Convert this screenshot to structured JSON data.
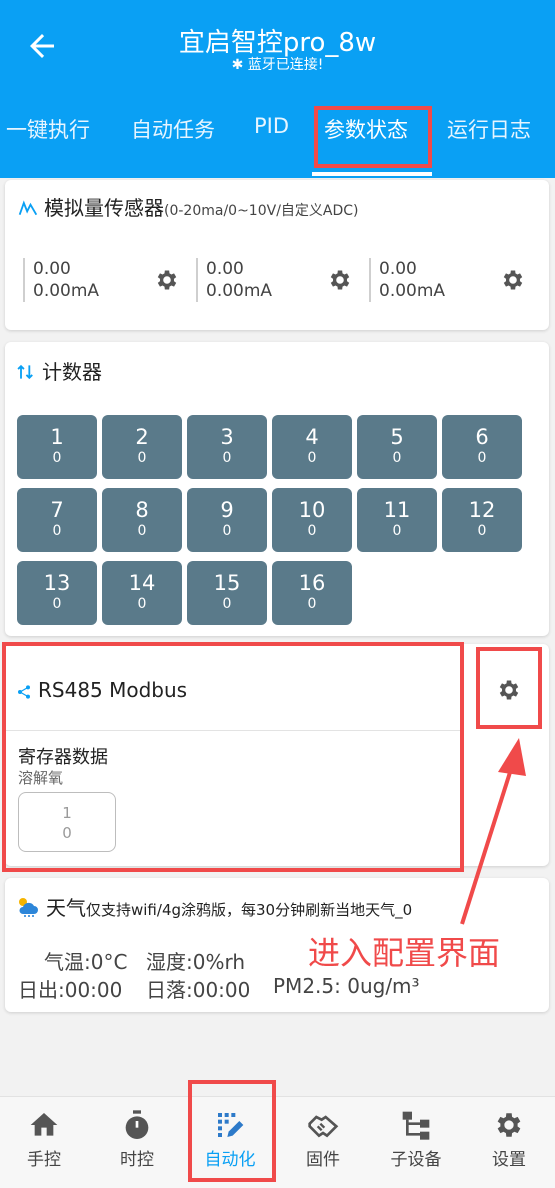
{
  "header": {
    "title": "宜启智控pro_8w",
    "subtitle": "✱ 蓝牙已连接!",
    "back_icon": "arrow-left-icon",
    "bg_color": "#0aa0f4"
  },
  "tabs": [
    {
      "label": "一键执行"
    },
    {
      "label": "自动任务"
    },
    {
      "label": "PID"
    },
    {
      "label": "参数状态",
      "active": true
    },
    {
      "label": "运行日志"
    }
  ],
  "analog": {
    "title": "模拟量传感器",
    "subtitle": "(0-20ma/0~10V/自定义ADC)",
    "channels": [
      {
        "value": "0.00",
        "current": "0.00mA"
      },
      {
        "value": "0.00",
        "current": "0.00mA"
      },
      {
        "value": "0.00",
        "current": "0.00mA"
      }
    ]
  },
  "counter": {
    "title": "计数器",
    "items": [
      {
        "n": "1",
        "v": "0"
      },
      {
        "n": "2",
        "v": "0"
      },
      {
        "n": "3",
        "v": "0"
      },
      {
        "n": "4",
        "v": "0"
      },
      {
        "n": "5",
        "v": "0"
      },
      {
        "n": "6",
        "v": "0"
      },
      {
        "n": "7",
        "v": "0"
      },
      {
        "n": "8",
        "v": "0"
      },
      {
        "n": "9",
        "v": "0"
      },
      {
        "n": "10",
        "v": "0"
      },
      {
        "n": "11",
        "v": "0"
      },
      {
        "n": "12",
        "v": "0"
      },
      {
        "n": "13",
        "v": "0"
      },
      {
        "n": "14",
        "v": "0"
      },
      {
        "n": "15",
        "v": "0"
      },
      {
        "n": "16",
        "v": "0"
      }
    ]
  },
  "modbus": {
    "title": "RS485 Modbus",
    "section": "寄存器数据",
    "register_name": "溶解氧",
    "register_index": "1",
    "register_value": "0"
  },
  "weather": {
    "title": "天气",
    "note": "仅支持wifi/4g涂鸦版，每30分钟刷新当地天气_0",
    "temp": "气温:0°C",
    "humidity": "湿度:0%rh",
    "sunrise": "日出:00:00",
    "sunset": "日落:00:00",
    "pm25": "PM2.5: 0ug/m³"
  },
  "annotation": "进入配置界面",
  "bottom_nav": [
    {
      "label": "手控",
      "icon": "home-icon"
    },
    {
      "label": "时控",
      "icon": "stopwatch-icon"
    },
    {
      "label": "自动化",
      "icon": "automation-icon",
      "active": true
    },
    {
      "label": "固件",
      "icon": "handshake-icon"
    },
    {
      "label": "子设备",
      "icon": "sitemap-icon"
    },
    {
      "label": "设置",
      "icon": "gear-icon"
    }
  ]
}
